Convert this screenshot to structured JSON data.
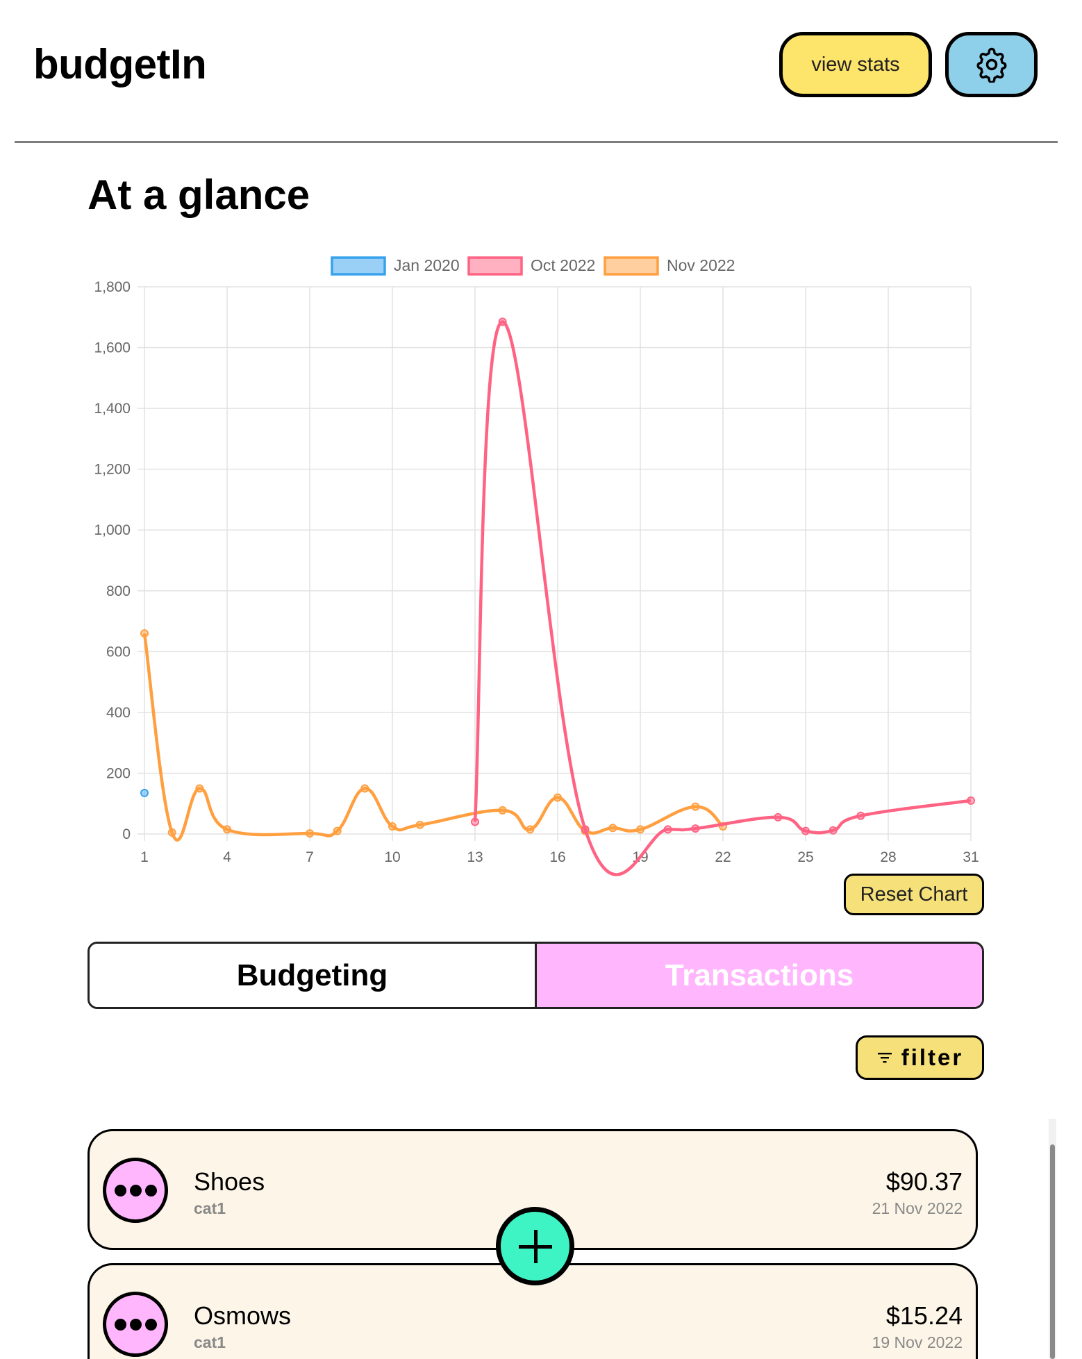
{
  "header": {
    "app_title": "budgetIn",
    "view_stats_label": "view stats",
    "settings_icon": "gear-icon"
  },
  "main": {
    "section_title": "At a glance",
    "reset_chart_label": "Reset Chart",
    "tabs": [
      {
        "label": "Budgeting",
        "active": false
      },
      {
        "label": "Transactions",
        "active": true
      }
    ],
    "filter_label": "filter",
    "filter_icon": "filter-lines-icon",
    "add_icon": "plus-icon"
  },
  "colors": {
    "jan_2020": "#36a2eb",
    "oct_2022": "#ff6384",
    "nov_2022": "#ff9f40",
    "view_stats_bg": "#fde46b",
    "settings_bg": "#8ecfea",
    "tab_active_bg": "#ffb6fd",
    "fab_bg": "#3ef4c4",
    "card_bg": "#fdf6e8"
  },
  "transactions": [
    {
      "name": "Shoes",
      "category": "cat1",
      "amount": "$90.37",
      "date": "21 Nov 2022"
    },
    {
      "name": "Osmows",
      "category": "cat1",
      "amount": "$15.24",
      "date": "19 Nov 2022"
    }
  ],
  "chart_data": {
    "type": "line",
    "title": "",
    "xlabel": "",
    "ylabel": "",
    "xlim": [
      1,
      31
    ],
    "ylim": [
      0,
      1800
    ],
    "x_ticks": [
      "1",
      "4",
      "7",
      "10",
      "13",
      "16",
      "19",
      "22",
      "25",
      "28",
      "31"
    ],
    "y_ticks": [
      "0",
      "200",
      "400",
      "600",
      "800",
      "1,000",
      "1,200",
      "1,400",
      "1,600",
      "1,800"
    ],
    "grid": true,
    "legend_position": "top",
    "series": [
      {
        "name": "Jan 2020",
        "color": "#36a2eb",
        "x": [
          1
        ],
        "y": [
          135
        ]
      },
      {
        "name": "Oct 2022",
        "color": "#ff6384",
        "x": [
          13,
          14,
          17,
          20,
          21,
          24,
          25,
          26,
          27,
          31
        ],
        "y": [
          40,
          1685,
          15,
          15,
          18,
          55,
          10,
          12,
          60,
          110
        ]
      },
      {
        "name": "Nov 2022",
        "color": "#ff9f40",
        "x": [
          1,
          2,
          3,
          4,
          7,
          8,
          9,
          10,
          11,
          14,
          15,
          16,
          17,
          18,
          19,
          21,
          22
        ],
        "y": [
          660,
          5,
          150,
          15,
          2,
          10,
          150,
          25,
          30,
          78,
          15,
          120,
          10,
          20,
          15,
          90,
          25
        ]
      }
    ]
  }
}
